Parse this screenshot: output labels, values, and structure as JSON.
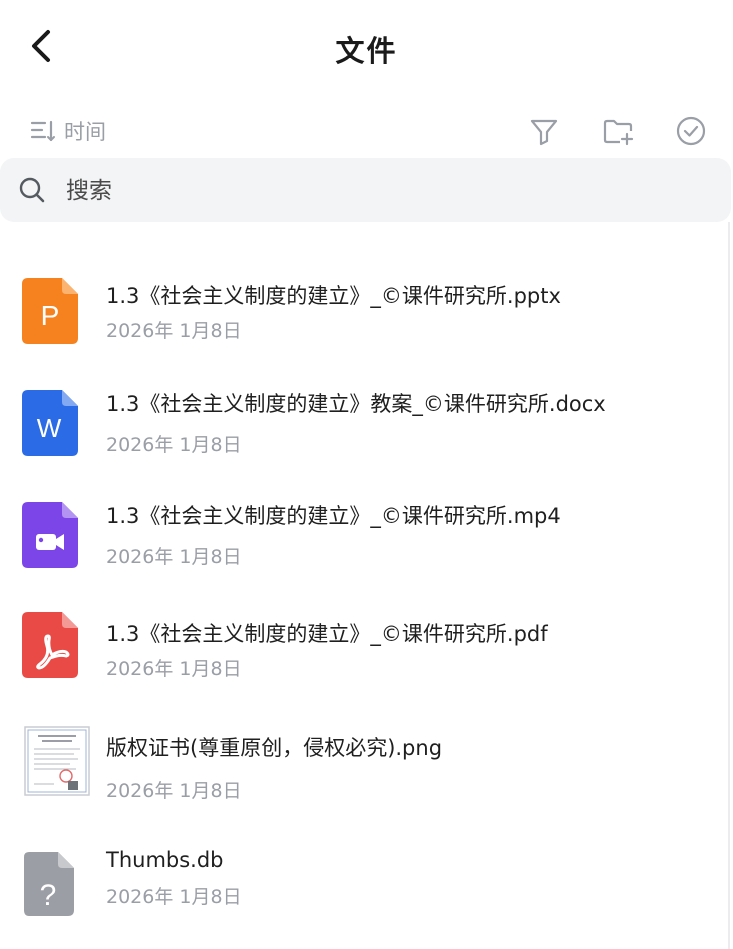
{
  "header": {
    "title": "文件"
  },
  "toolbar": {
    "sort_label": "时间"
  },
  "search": {
    "placeholder": "搜索",
    "value": ""
  },
  "files": [
    {
      "name": "1.3《社会主义制度的建立》_©课件研究所.pptx",
      "date": "2026年 1月8日",
      "type": "pptx",
      "icon": "ppt-file-icon",
      "color": "#f5821f"
    },
    {
      "name": " 1.3《社会主义制度的建立》教案_©课件研究所.docx",
      "date": "2026年 1月8日",
      "type": "docx",
      "icon": "word-file-icon",
      "color": "#2b6be6"
    },
    {
      "name": "1.3《社会主义制度的建立》_©课件研究所.mp4",
      "date": "2026年 1月8日",
      "type": "mp4",
      "icon": "video-file-icon",
      "color": "#7b45e8"
    },
    {
      "name": "1.3《社会主义制度的建立》_©课件研究所.pdf",
      "date": "2026年 1月8日",
      "type": "pdf",
      "icon": "pdf-file-icon",
      "color": "#ea4a45"
    },
    {
      "name": "版权证书(尊重原创，侵权必究).png",
      "date": "2026年 1月8日",
      "type": "png",
      "icon": "certificate-image-thumbnail",
      "color": "#c8ccd2"
    },
    {
      "name": "Thumbs.db",
      "date": "2026年 1月8日",
      "type": "db",
      "icon": "unknown-file-icon",
      "color": "#9b9ea5"
    }
  ]
}
